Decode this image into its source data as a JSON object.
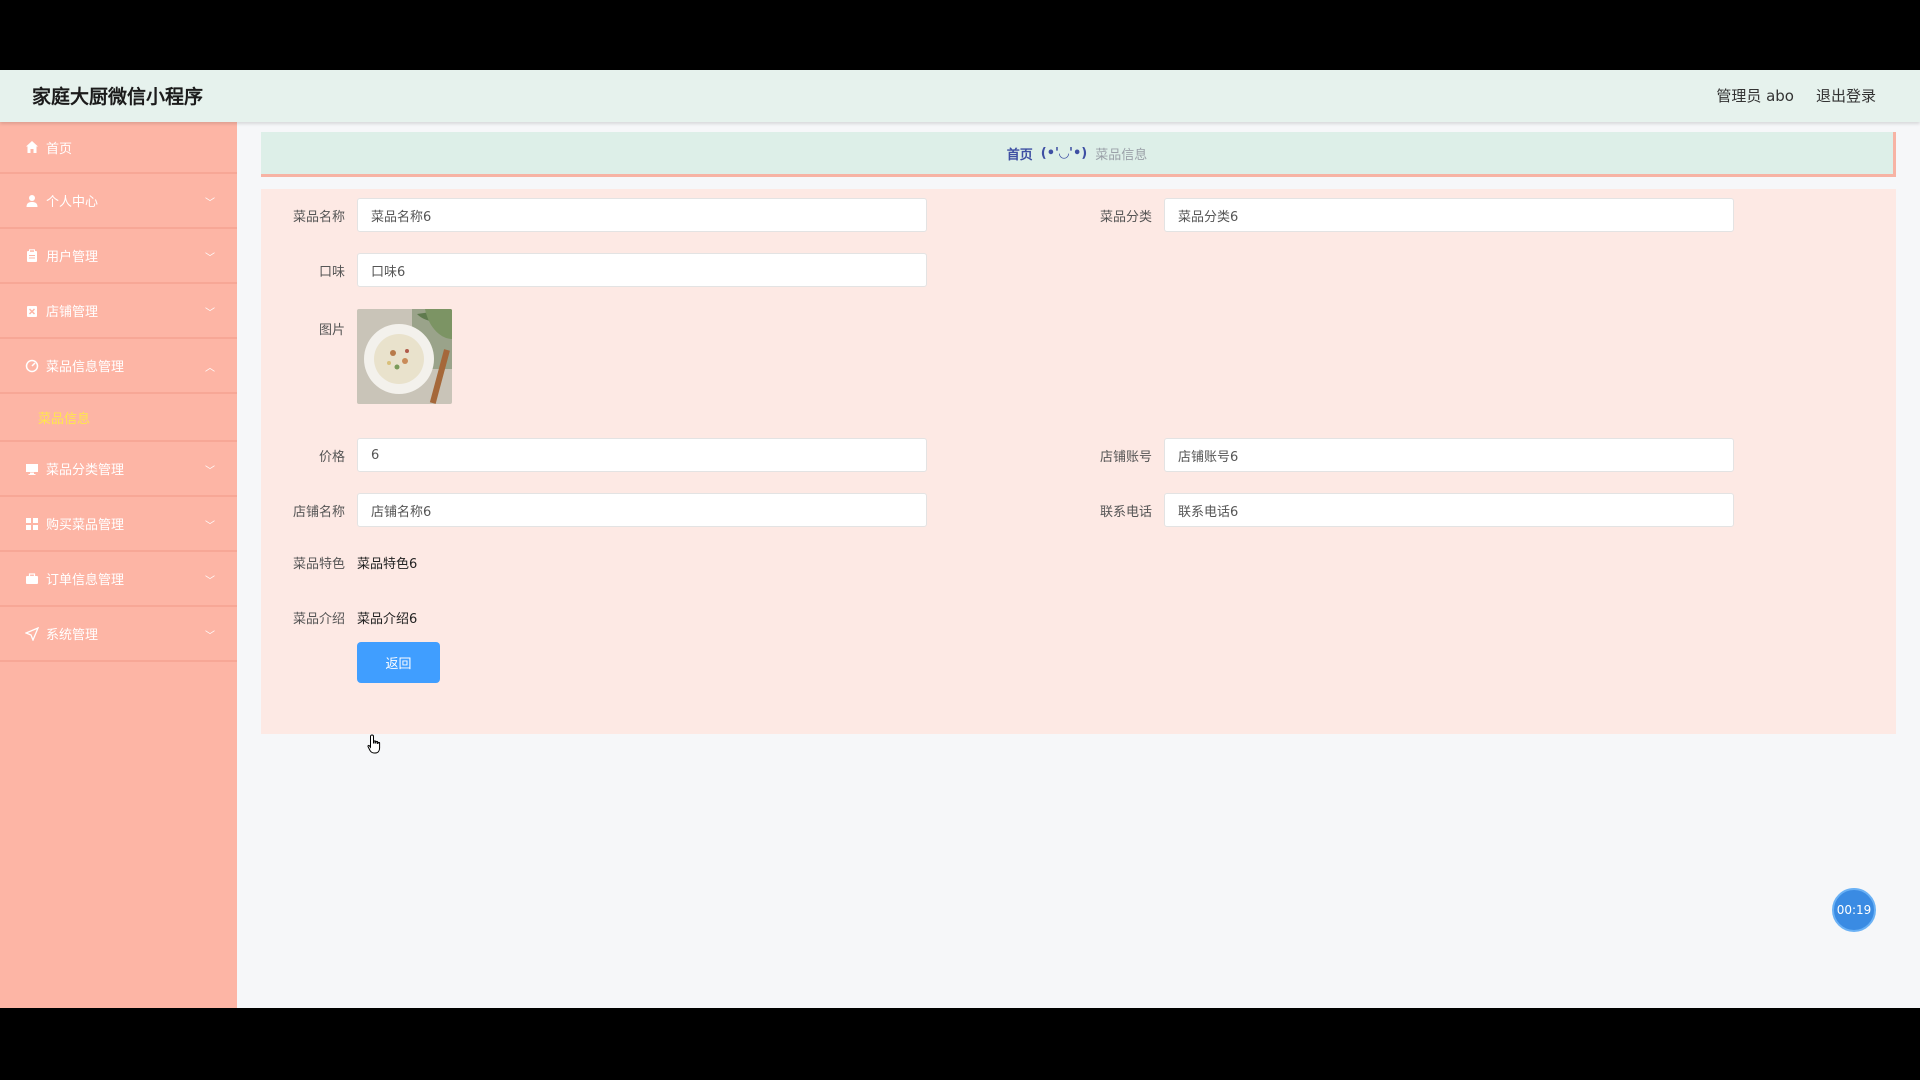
{
  "header": {
    "title": "家庭大厨微信小程序",
    "user": "管理员 abo",
    "logout": "退出登录"
  },
  "sidebar": {
    "items": [
      {
        "label": "首页",
        "icon": "home-icon"
      },
      {
        "label": "个人中心",
        "icon": "user-icon"
      },
      {
        "label": "用户管理",
        "icon": "clipboard-icon"
      },
      {
        "label": "店铺管理",
        "icon": "close-box-icon"
      },
      {
        "label": "菜品信息管理",
        "icon": "dashboard-icon",
        "expanded": true
      },
      {
        "label": "菜品分类管理",
        "icon": "monitor-icon"
      },
      {
        "label": "购买菜品管理",
        "icon": "grid-icon"
      },
      {
        "label": "订单信息管理",
        "icon": "briefcase-icon"
      },
      {
        "label": "系统管理",
        "icon": "send-icon"
      }
    ],
    "submenu": {
      "label": "菜品信息"
    }
  },
  "breadcrumb": {
    "home": "首页",
    "separator": "(•'◡'•)",
    "current": "菜品信息"
  },
  "form": {
    "dish_name": {
      "label": "菜品名称",
      "value": "菜品名称6"
    },
    "dish_category": {
      "label": "菜品分类",
      "value": "菜品分类6"
    },
    "flavor": {
      "label": "口味",
      "value": "口味6"
    },
    "picture": {
      "label": "图片"
    },
    "price": {
      "label": "价格",
      "value": "6"
    },
    "shop_account": {
      "label": "店铺账号",
      "value": "店铺账号6"
    },
    "shop_name": {
      "label": "店铺名称",
      "value": "店铺名称6"
    },
    "phone": {
      "label": "联系电话",
      "value": "联系电话6"
    },
    "feature": {
      "label": "菜品特色",
      "value": "菜品特色6"
    },
    "intro": {
      "label": "菜品介绍",
      "value": "菜品介绍6"
    },
    "back_button": "返回"
  },
  "timer": "00:19",
  "colors": {
    "sidebar": "#fdb5a5",
    "topbar": "#e6f2ed",
    "card": "#fde9e4",
    "button": "#409eff",
    "submenu_active": "#ffe74c"
  }
}
